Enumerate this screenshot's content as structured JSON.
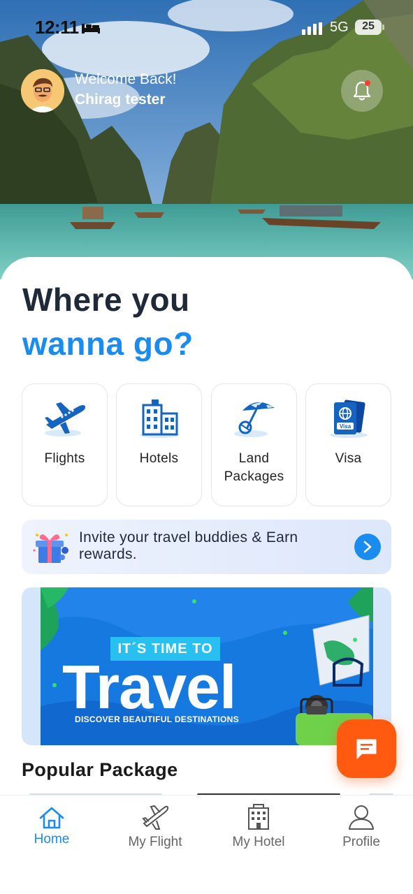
{
  "status_bar": {
    "time": "12:11",
    "network": "5G",
    "battery": "25"
  },
  "header": {
    "greeting": "Welcome Back!",
    "user_name": "Chirag tester"
  },
  "headline": {
    "line1": "Where you",
    "line2": "wanna go?"
  },
  "categories": [
    {
      "label": "Flights",
      "icon": "airplane-icon"
    },
    {
      "label": "Hotels",
      "icon": "hotel-building-icon"
    },
    {
      "label": "Land Packages",
      "icon": "beach-umbrella-icon"
    },
    {
      "label": "Visa",
      "icon": "passport-icon"
    }
  ],
  "invite": {
    "text": "Invite your travel buddies & Earn rewards."
  },
  "banner": {
    "tag": "IT´S TIME TO",
    "title": "Travel",
    "subtitle": "DISCOVER BEAUTIFUL DESTINATIONS"
  },
  "popular": {
    "title": "Popular Package"
  },
  "bottom_nav": [
    {
      "label": "Home",
      "icon": "home-icon",
      "active": true
    },
    {
      "label": "My Flight",
      "icon": "airplane-icon",
      "active": false
    },
    {
      "label": "My Hotel",
      "icon": "hotel-building-icon",
      "active": false
    },
    {
      "label": "Profile",
      "icon": "person-icon",
      "active": false
    }
  ],
  "colors": {
    "accent": "#1a8cf0",
    "fab": "#ff5a10",
    "text_dark": "#1f2937"
  }
}
